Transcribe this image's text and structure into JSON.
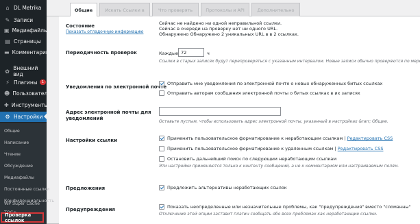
{
  "sidebar": {
    "site_name": "DL Metrika",
    "items": [
      {
        "label": "Записи",
        "icon": "pin-icon"
      },
      {
        "label": "Медиафайлы",
        "icon": "media-icon"
      },
      {
        "label": "Страницы",
        "icon": "pages-icon"
      },
      {
        "label": "Комментарии",
        "icon": "comments-icon"
      },
      {
        "label": "Внешний вид",
        "icon": "appearance-icon"
      },
      {
        "label": "Плагины",
        "icon": "plugins-icon",
        "badge": "1"
      },
      {
        "label": "Пользователи",
        "icon": "users-icon"
      },
      {
        "label": "Инструменты",
        "icon": "tools-icon"
      },
      {
        "label": "Настройки",
        "icon": "settings-icon"
      }
    ],
    "submenu": [
      "Общие",
      "Написание",
      "Чтение",
      "Обсуждение",
      "Медиафайлы",
      "Постоянные ссылки",
      "Конфиденциальность",
      "TOC+",
      "WP Super Cache",
      "Проверка ссылок"
    ]
  },
  "tabs": [
    "Общие",
    "Искать Ссылки в",
    "Что проверять",
    "Протоколы и API",
    "Дополнительно"
  ],
  "settings": {
    "status": {
      "label": "Состояние",
      "link": "Показать отладочную информацию",
      "line1": "Сейчас не найдено ни одной неправильной ссылки.",
      "line2": "Сейчас в очереди на проверку нет ни одного URL.",
      "line3": "Обнаружено Обнаружено 2 уникальных URL в в 2 ссылках."
    },
    "frequency": {
      "label": "Периодичность проверок",
      "prefix": "Каждые",
      "value": "72",
      "unit": "ч",
      "desc": "Ссылки в старых записях будут перепроверяться с указанным интервалом. Новые записи обычно проверяются по мере их"
    },
    "email_notify": {
      "label": "Уведомления по электронной почте",
      "opt1": "Отправить мне уведомления по электронной почте о новых обнаруженных битых ссылках",
      "opt2": "Отправить авторам сообщения электронной почты о битых ссылках в их записях"
    },
    "email_addr": {
      "label1": "Адрес электронной почты для",
      "label2": "уведомлений",
      "value": "",
      "desc": "Оставьте пустым, чтобы использовать адрес электронной почты, указанный в настройках &rarr; Общие."
    },
    "link_settings": {
      "label": "Настройки ссылки",
      "opt1": "Применить пользовательское форматирование к неработающим ссылкам",
      "opt1_link": "Редактировать CSS",
      "opt2": "Применить пользовательское форматирование к удаленным ссылкам",
      "opt2_link": "Редактировать CSS",
      "opt3": "Остановить дальнейший поиск по следующим неработающим ссылкам",
      "desc": "Эти настройки применяются только к контенту сообщений, а не к комментариям или настраиваемым полям."
    },
    "suggestions": {
      "label": "Предложения",
      "opt1": "Предложить альтернативы неработающих ссылок"
    },
    "warnings": {
      "label": "Предупреждения",
      "opt1": "Показать неопределенные или незначительные проблемы, как \"предупреждения\" вместо \"сломанны\"",
      "desc": "Отключение этой опции заставит плагин сообщать обо всех проблемах как неработающие ссылки."
    }
  },
  "colors": {
    "sidebar_bg": "#1d2327",
    "accent": "#2271b1",
    "highlight": "#d63638"
  }
}
